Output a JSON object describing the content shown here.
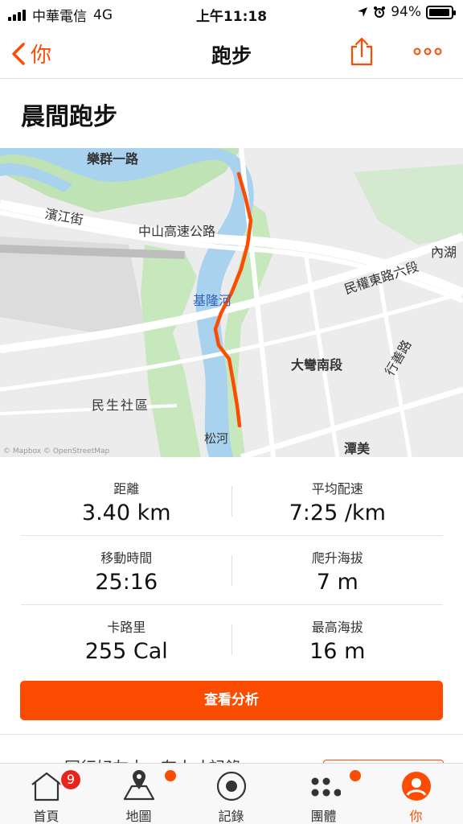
{
  "status_bar": {
    "carrier": "中華電信",
    "network": "4G",
    "time": "上午11:18",
    "battery": "94%"
  },
  "nav": {
    "back_label": "你",
    "title": "跑步",
    "icons": [
      "chevron-left-icon",
      "share-icon",
      "more-icon"
    ]
  },
  "activity": {
    "title": "晨間跑步"
  },
  "map": {
    "labels": {
      "road_top": "樂群一路",
      "road_binjiang": "濱江街",
      "highway": "中山高速公路",
      "neihu": "內湖",
      "minquan": "民權東路六段",
      "river": "基隆河",
      "dawan": "大彎南段",
      "xingshan": "行善路",
      "minsheng": "民生社區",
      "songhe": "松河",
      "tanmei": "潭美"
    },
    "attribution": "© Mapbox © OpenStreetMap",
    "route_color": "#fc4c02"
  },
  "stats": [
    {
      "label": "距離",
      "value": "3.40 km"
    },
    {
      "label": "平均配速",
      "value": "7:25 /km"
    },
    {
      "label": "移動時間",
      "value": "25:16"
    },
    {
      "label": "爬升海拔",
      "value": "7 m"
    },
    {
      "label": "卡路里",
      "value": "255 Cal"
    },
    {
      "label": "最高海拔",
      "value": "16 m"
    }
  ],
  "analyze_button": "查看分析",
  "peek_text": "同行好友本一有人才記錄",
  "tabs": [
    {
      "label": "首頁",
      "icon": "home-icon",
      "badge": "9"
    },
    {
      "label": "地圖",
      "icon": "map-icon",
      "dot": true
    },
    {
      "label": "記錄",
      "icon": "record-icon"
    },
    {
      "label": "團體",
      "icon": "groups-icon",
      "dot": true
    },
    {
      "label": "你",
      "icon": "profile-icon",
      "active": true
    }
  ],
  "colors": {
    "accent": "#fc4c02",
    "badge": "#e8241c"
  }
}
